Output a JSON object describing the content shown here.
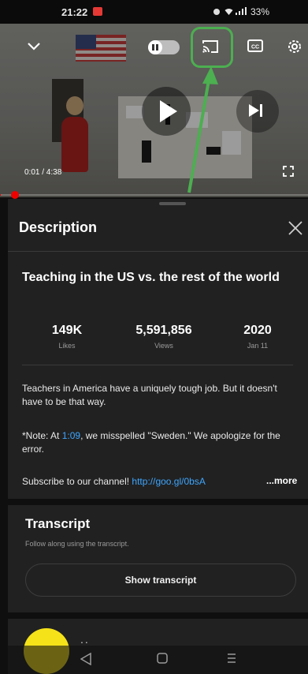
{
  "status_bar": {
    "time": "21:22",
    "battery": "33%"
  },
  "player": {
    "time_readout": "0:01 / 4:38",
    "progress_fraction": 0.003
  },
  "description_panel": {
    "header": "Description",
    "video_title": "Teaching in the US vs. the rest of the world",
    "stats": [
      {
        "value": "149K",
        "label": "Likes"
      },
      {
        "value": "5,591,856",
        "label": "Views"
      },
      {
        "value": "2020",
        "label": "Jan 11"
      }
    ],
    "paragraph1": "Teachers in America have a uniquely tough job. But it doesn't have to be that way.",
    "note_prefix": "*Note: At ",
    "note_timestamp": "1:09",
    "note_suffix": ", we misspelled \"Sweden.\" We apologize for the error.",
    "subscribe_prefix": "Subscribe to our channel! ",
    "subscribe_link": "http://goo.gl/0bsA",
    "more_label": "...more"
  },
  "transcript": {
    "title": "Transcript",
    "subtitle": "Follow along using the transcript.",
    "button_label": "Show transcript"
  },
  "channel": {
    "dots": ".."
  },
  "colors": {
    "accent_highlight": "#4caf50",
    "link": "#3ea6ff",
    "progress": "#ff0000",
    "avatar": "#f5e219"
  }
}
